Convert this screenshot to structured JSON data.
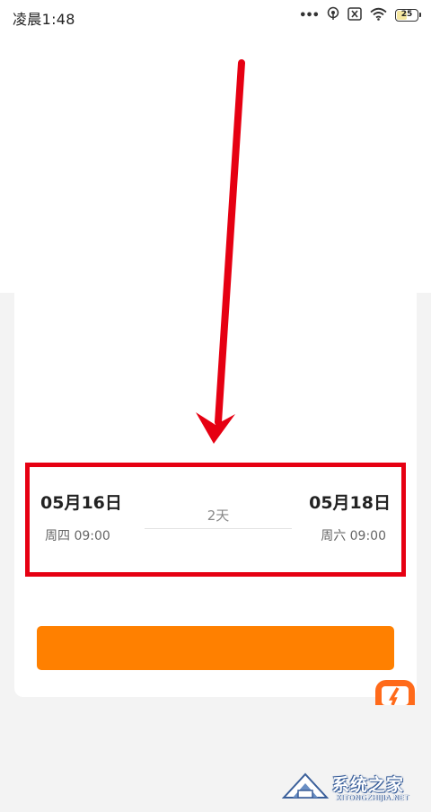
{
  "status_bar": {
    "time": "凌晨1:48",
    "battery": "25"
  },
  "trip": {
    "start_date": "05月16日",
    "start_time": "周四 09:00",
    "duration": "2天",
    "end_date": "05月18日",
    "end_time": "周六 09:00"
  },
  "book_button": {
    "label": ""
  },
  "watermark": {
    "brand": "系统之家",
    "url": "XITONGZHIJIA.NET"
  },
  "colors": {
    "accent": "#ff8000",
    "highlight": "#e60012",
    "background": "#f3f3f3"
  },
  "icons": [
    "signal-dots-icon",
    "hotspot-icon",
    "no-sim-icon",
    "wifi-icon",
    "battery-icon",
    "app-float-icon",
    "red-arrow-annotation"
  ]
}
